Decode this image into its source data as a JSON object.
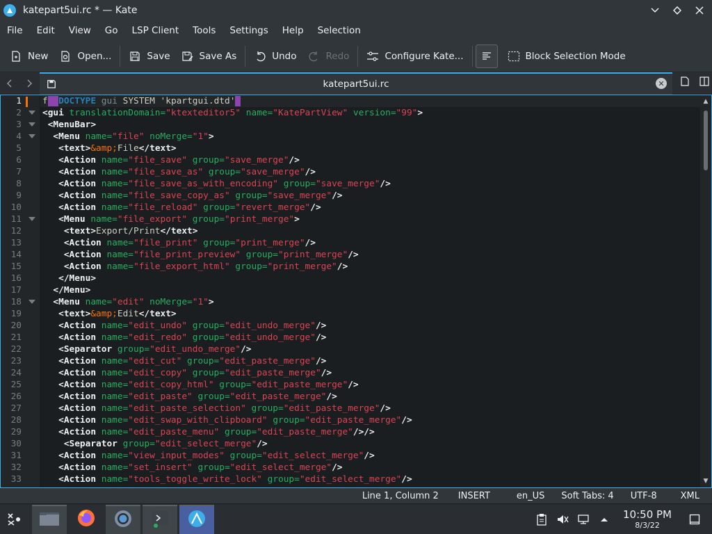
{
  "window": {
    "title": "katepart5ui.rc * — Kate"
  },
  "menubar": {
    "items": [
      "File",
      "Edit",
      "View",
      "Go",
      "LSP Client",
      "Tools",
      "Settings",
      "Help",
      "Selection"
    ]
  },
  "toolbar": {
    "new_label": "New",
    "open_label": "Open...",
    "save_label": "Save",
    "save_as_label": "Save As",
    "undo_label": "Undo",
    "redo_label": "Redo",
    "configure_label": "Configure Kate...",
    "block_selection_label": "Block Selection Mode"
  },
  "tab": {
    "label": "katepart5ui.rc"
  },
  "editor": {
    "lines": [
      {
        "n": "1",
        "fold": false
      },
      {
        "n": "2",
        "fold": true
      },
      {
        "n": "3",
        "fold": true
      },
      {
        "n": "4",
        "fold": true
      },
      {
        "n": "5",
        "fold": false
      },
      {
        "n": "6",
        "fold": false
      },
      {
        "n": "7",
        "fold": false
      },
      {
        "n": "8",
        "fold": false
      },
      {
        "n": "9",
        "fold": false
      },
      {
        "n": "10",
        "fold": false
      },
      {
        "n": "11",
        "fold": true
      },
      {
        "n": "12",
        "fold": false
      },
      {
        "n": "13",
        "fold": false
      },
      {
        "n": "14",
        "fold": false
      },
      {
        "n": "15",
        "fold": false
      },
      {
        "n": "16",
        "fold": false
      },
      {
        "n": "17",
        "fold": false
      },
      {
        "n": "18",
        "fold": true
      },
      {
        "n": "19",
        "fold": false
      },
      {
        "n": "20",
        "fold": false
      },
      {
        "n": "21",
        "fold": false
      },
      {
        "n": "22",
        "fold": false
      },
      {
        "n": "23",
        "fold": false
      },
      {
        "n": "24",
        "fold": false
      },
      {
        "n": "25",
        "fold": false
      },
      {
        "n": "26",
        "fold": false
      },
      {
        "n": "27",
        "fold": false
      },
      {
        "n": "28",
        "fold": false
      },
      {
        "n": "29",
        "fold": false
      },
      {
        "n": "30",
        "fold": false
      },
      {
        "n": "31",
        "fold": false
      },
      {
        "n": "32",
        "fold": false
      },
      {
        "n": "33",
        "fold": false
      }
    ],
    "code": [
      [
        [
          "text",
          "f"
        ],
        [
          "hl",
          "  "
        ],
        [
          "doc",
          "DOCTYPE"
        ],
        [
          "text",
          " "
        ],
        [
          "gui",
          "gui"
        ],
        [
          "text",
          " SYSTEM 'kpartgui.dtd'"
        ],
        [
          "hl",
          " "
        ]
      ],
      [
        [
          "tag",
          "<gui"
        ],
        [
          "attr",
          " translationDomain="
        ],
        [
          "val",
          "\"ktexteditor5\""
        ],
        [
          "attr",
          " name="
        ],
        [
          "val",
          "\"KatePartView\""
        ],
        [
          "attr",
          " version="
        ],
        [
          "val",
          "\"99\""
        ],
        [
          "tag",
          ">"
        ]
      ],
      [
        [
          "tag",
          " <MenuBar>"
        ]
      ],
      [
        [
          "tag",
          "  <Menu"
        ],
        [
          "attr",
          " name="
        ],
        [
          "val",
          "\"file\""
        ],
        [
          "attr",
          " noMerge="
        ],
        [
          "val",
          "\"1\""
        ],
        [
          "tag",
          ">"
        ]
      ],
      [
        [
          "tag",
          "   <text>"
        ],
        [
          "ent",
          "&amp;"
        ],
        [
          "text",
          "File"
        ],
        [
          "tag",
          "</text>"
        ]
      ],
      [
        [
          "tag",
          "   <Action"
        ],
        [
          "attr",
          " name="
        ],
        [
          "val",
          "\"file_save\""
        ],
        [
          "attr",
          " group="
        ],
        [
          "val",
          "\"save_merge\""
        ],
        [
          "tag",
          "/>"
        ]
      ],
      [
        [
          "tag",
          "   <Action"
        ],
        [
          "attr",
          " name="
        ],
        [
          "val",
          "\"file_save_as\""
        ],
        [
          "attr",
          " group="
        ],
        [
          "val",
          "\"save_merge\""
        ],
        [
          "tag",
          "/>"
        ]
      ],
      [
        [
          "tag",
          "   <Action"
        ],
        [
          "attr",
          " name="
        ],
        [
          "val",
          "\"file_save_as_with_encoding\""
        ],
        [
          "attr",
          " group="
        ],
        [
          "val",
          "\"save_merge\""
        ],
        [
          "tag",
          "/>"
        ]
      ],
      [
        [
          "tag",
          "   <Action"
        ],
        [
          "attr",
          " name="
        ],
        [
          "val",
          "\"file_save_copy_as\""
        ],
        [
          "attr",
          " group="
        ],
        [
          "val",
          "\"save_merge\""
        ],
        [
          "tag",
          "/>"
        ]
      ],
      [
        [
          "tag",
          "   <Action"
        ],
        [
          "attr",
          " name="
        ],
        [
          "val",
          "\"file_reload\""
        ],
        [
          "attr",
          " group="
        ],
        [
          "val",
          "\"revert_merge\""
        ],
        [
          "tag",
          "/>"
        ]
      ],
      [
        [
          "tag",
          "   <Menu"
        ],
        [
          "attr",
          " name="
        ],
        [
          "val",
          "\"file_export\""
        ],
        [
          "attr",
          " group="
        ],
        [
          "val",
          "\"print_merge\""
        ],
        [
          "tag",
          ">"
        ]
      ],
      [
        [
          "tag",
          "    <text>"
        ],
        [
          "text",
          "Export/Print"
        ],
        [
          "tag",
          "</text>"
        ]
      ],
      [
        [
          "tag",
          "    <Action"
        ],
        [
          "attr",
          " name="
        ],
        [
          "val",
          "\"file_print\""
        ],
        [
          "attr",
          " group="
        ],
        [
          "val",
          "\"print_merge\""
        ],
        [
          "tag",
          "/>"
        ]
      ],
      [
        [
          "tag",
          "    <Action"
        ],
        [
          "attr",
          " name="
        ],
        [
          "val",
          "\"file_print_preview\""
        ],
        [
          "attr",
          " group="
        ],
        [
          "val",
          "\"print_merge\""
        ],
        [
          "tag",
          "/>"
        ]
      ],
      [
        [
          "tag",
          "    <Action"
        ],
        [
          "attr",
          " name="
        ],
        [
          "val",
          "\"file_export_html\""
        ],
        [
          "attr",
          " group="
        ],
        [
          "val",
          "\"print_merge\""
        ],
        [
          "tag",
          "/>"
        ]
      ],
      [
        [
          "tag",
          "   </Menu>"
        ]
      ],
      [
        [
          "tag",
          "  </Menu>"
        ]
      ],
      [
        [
          "tag",
          "  <Menu"
        ],
        [
          "attr",
          " name="
        ],
        [
          "val",
          "\"edit\""
        ],
        [
          "attr",
          " noMerge="
        ],
        [
          "val",
          "\"1\""
        ],
        [
          "tag",
          ">"
        ]
      ],
      [
        [
          "tag",
          "   <text>"
        ],
        [
          "ent",
          "&amp;"
        ],
        [
          "text",
          "Edit"
        ],
        [
          "tag",
          "</text>"
        ]
      ],
      [
        [
          "tag",
          "   <Action"
        ],
        [
          "attr",
          " name="
        ],
        [
          "val",
          "\"edit_undo\""
        ],
        [
          "attr",
          " group="
        ],
        [
          "val",
          "\"edit_undo_merge\""
        ],
        [
          "tag",
          "/>"
        ]
      ],
      [
        [
          "tag",
          "   <Action"
        ],
        [
          "attr",
          " name="
        ],
        [
          "val",
          "\"edit_redo\""
        ],
        [
          "attr",
          " group="
        ],
        [
          "val",
          "\"edit_undo_merge\""
        ],
        [
          "tag",
          "/>"
        ]
      ],
      [
        [
          "tag",
          "   <Separator"
        ],
        [
          "attr",
          " group="
        ],
        [
          "val",
          "\"edit_undo_merge\""
        ],
        [
          "tag",
          "/>"
        ]
      ],
      [
        [
          "tag",
          "   <Action"
        ],
        [
          "attr",
          " name="
        ],
        [
          "val",
          "\"edit_cut\""
        ],
        [
          "attr",
          " group="
        ],
        [
          "val",
          "\"edit_paste_merge\""
        ],
        [
          "tag",
          "/>"
        ]
      ],
      [
        [
          "tag",
          "   <Action"
        ],
        [
          "attr",
          " name="
        ],
        [
          "val",
          "\"edit_copy\""
        ],
        [
          "attr",
          " group="
        ],
        [
          "val",
          "\"edit_paste_merge\""
        ],
        [
          "tag",
          "/>"
        ]
      ],
      [
        [
          "tag",
          "   <Action"
        ],
        [
          "attr",
          " name="
        ],
        [
          "val",
          "\"edit_copy_html\""
        ],
        [
          "attr",
          " group="
        ],
        [
          "val",
          "\"edit_paste_merge\""
        ],
        [
          "tag",
          "/>"
        ]
      ],
      [
        [
          "tag",
          "   <Action"
        ],
        [
          "attr",
          " name="
        ],
        [
          "val",
          "\"edit_paste\""
        ],
        [
          "attr",
          " group="
        ],
        [
          "val",
          "\"edit_paste_merge\""
        ],
        [
          "tag",
          "/>"
        ]
      ],
      [
        [
          "tag",
          "   <Action"
        ],
        [
          "attr",
          " name="
        ],
        [
          "val",
          "\"edit_paste_selection\""
        ],
        [
          "attr",
          " group="
        ],
        [
          "val",
          "\"edit_paste_merge\""
        ],
        [
          "tag",
          "/>"
        ]
      ],
      [
        [
          "tag",
          "   <Action"
        ],
        [
          "attr",
          " name="
        ],
        [
          "val",
          "\"edit_swap_with_clipboard\""
        ],
        [
          "attr",
          " group="
        ],
        [
          "val",
          "\"edit_paste_merge\""
        ],
        [
          "tag",
          "/>"
        ]
      ],
      [
        [
          "tag",
          "   <Action"
        ],
        [
          "attr",
          " name="
        ],
        [
          "val",
          "\"edit_paste_menu\""
        ],
        [
          "attr",
          " group="
        ],
        [
          "val",
          "\"edit_paste_merge\""
        ],
        [
          "tag",
          "/>/>"
        ]
      ],
      [
        [
          "tag",
          "    <Separator"
        ],
        [
          "attr",
          " group="
        ],
        [
          "val",
          "\"edit_select_merge\""
        ],
        [
          "tag",
          "/>"
        ]
      ],
      [
        [
          "tag",
          "   <Action"
        ],
        [
          "attr",
          " name="
        ],
        [
          "val",
          "\"view_input_modes\""
        ],
        [
          "attr",
          " group="
        ],
        [
          "val",
          "\"edit_select_merge\""
        ],
        [
          "tag",
          "/>"
        ]
      ],
      [
        [
          "tag",
          "   <Action"
        ],
        [
          "attr",
          " name="
        ],
        [
          "val",
          "\"set_insert\""
        ],
        [
          "attr",
          " group="
        ],
        [
          "val",
          "\"edit_select_merge\""
        ],
        [
          "tag",
          "/>"
        ]
      ],
      [
        [
          "tag",
          "   <Action"
        ],
        [
          "attr",
          " name="
        ],
        [
          "val",
          "\"tools_toggle_write_lock\""
        ],
        [
          "attr",
          " group="
        ],
        [
          "val",
          "\"edit_select_merge\""
        ],
        [
          "tag",
          "/>"
        ]
      ]
    ]
  },
  "statusbar": {
    "cursor": "Line 1, Column 2",
    "mode": "INSERT",
    "language": "en_US",
    "indent": "Soft Tabs: 4",
    "encoding": "UTF-8",
    "syntax": "XML"
  },
  "taskbar": {
    "time": "10:50 PM",
    "date": "8/3/22"
  },
  "colors": {
    "accent": "#3daee9",
    "tag": "#eff0f1",
    "attribute": "#27ae60",
    "value": "#da4453",
    "entity": "#f67400",
    "selection": "#8e44ad"
  }
}
